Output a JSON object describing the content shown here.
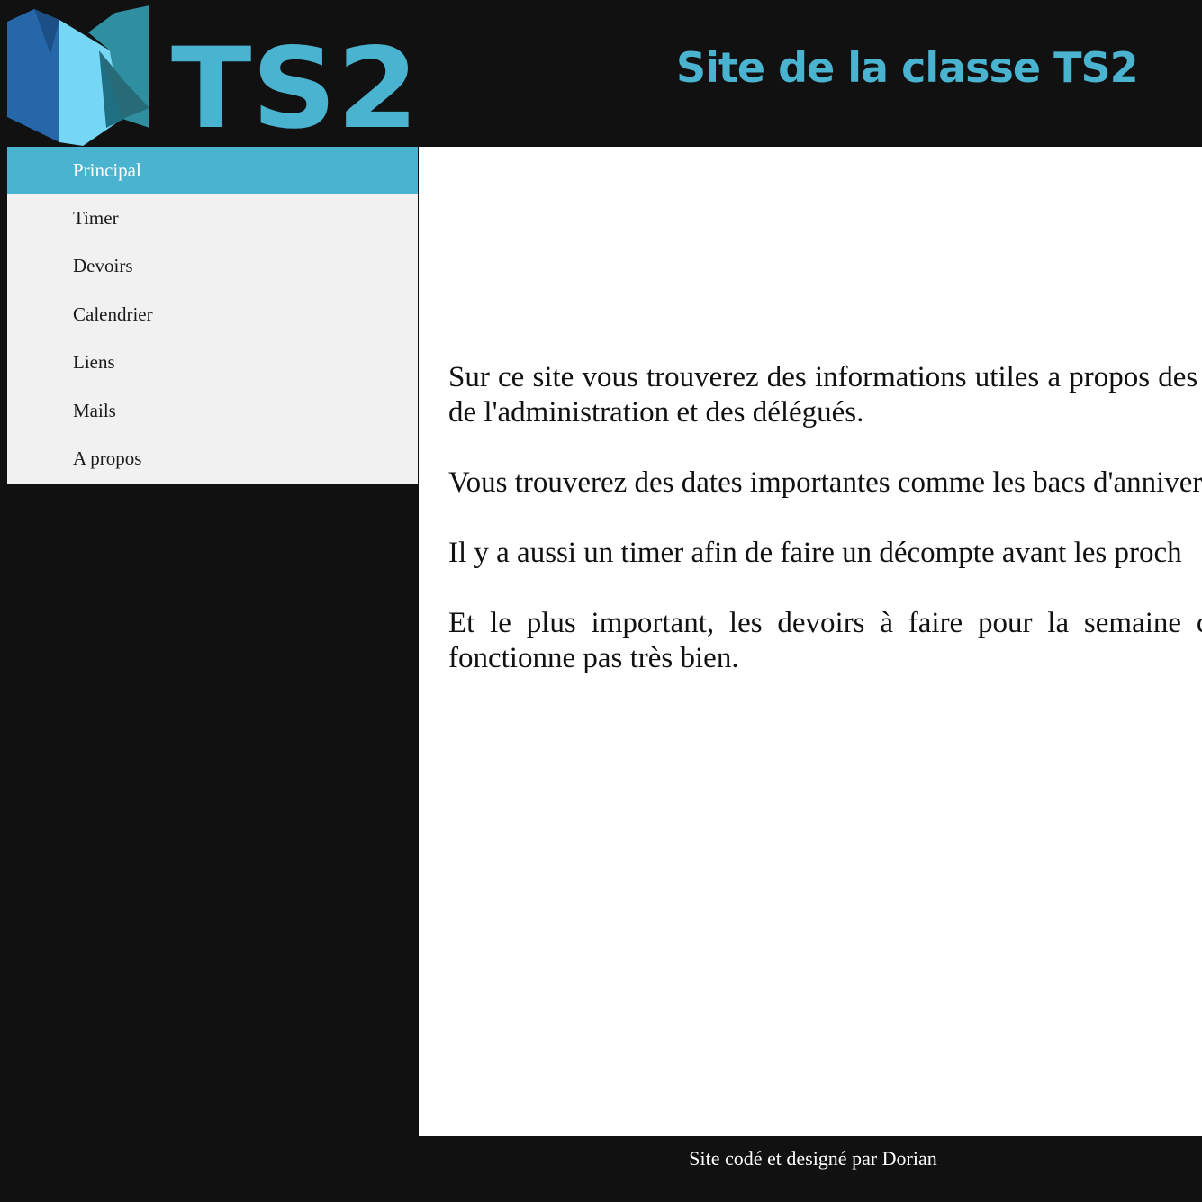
{
  "header": {
    "logo_text": "TS2",
    "title": "Site de la classe TS2"
  },
  "colors": {
    "accent": "#4ab3cf",
    "background": "#111111",
    "sidebar_bg": "#f1f1f1",
    "content_bg": "#ffffff"
  },
  "sidebar": {
    "items": [
      {
        "label": "Principal",
        "active": true
      },
      {
        "label": "Timer",
        "active": false
      },
      {
        "label": "Devoirs",
        "active": false
      },
      {
        "label": "Calendrier",
        "active": false
      },
      {
        "label": "Liens",
        "active": false
      },
      {
        "label": "Mails",
        "active": false
      },
      {
        "label": "A propos",
        "active": false
      }
    ]
  },
  "main": {
    "paragraphs": [
      "Sur ce site vous trouverez des informations utiles a propos des professeurs, de l'administration et des délégués.",
      "Vous trouverez des dates importantes comme les bacs d'anniversaire.",
      "Il y a aussi un timer afin de faire un décompte avant les proch",
      "Et le plus important, les devoirs à faire pour la semaine c directe ne fonctionne pas très bien."
    ]
  },
  "footer": {
    "text": "Site codé et designé par Dorian"
  }
}
